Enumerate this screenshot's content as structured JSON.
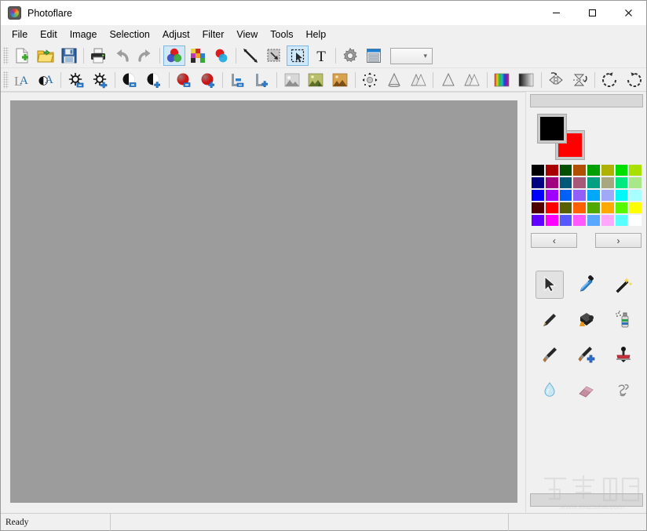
{
  "window": {
    "title": "Photoflare",
    "app_icon": "photoflare-logo-icon",
    "controls": [
      {
        "name": "minimize-button",
        "glyph": "minimize-icon"
      },
      {
        "name": "maximize-button",
        "glyph": "maximize-icon"
      },
      {
        "name": "close-button",
        "glyph": "close-icon"
      }
    ]
  },
  "menubar": {
    "items": [
      {
        "label": "File"
      },
      {
        "label": "Edit"
      },
      {
        "label": "Image"
      },
      {
        "label": "Selection"
      },
      {
        "label": "Adjust"
      },
      {
        "label": "Filter"
      },
      {
        "label": "View"
      },
      {
        "label": "Tools"
      },
      {
        "label": "Help"
      }
    ]
  },
  "toolbar_main": {
    "items": [
      {
        "name": "new-file-button",
        "icon": "new-document-icon",
        "active": false
      },
      {
        "name": "open-file-button",
        "icon": "open-folder-icon",
        "active": false
      },
      {
        "name": "save-file-button",
        "icon": "save-floppy-icon",
        "active": false
      },
      {
        "name": "separator",
        "icon": "separator",
        "active": false
      },
      {
        "name": "print-button",
        "icon": "printer-icon",
        "active": false
      },
      {
        "name": "undo-button",
        "icon": "undo-arrow-icon",
        "active": false
      },
      {
        "name": "redo-button",
        "icon": "redo-arrow-icon",
        "active": false
      },
      {
        "name": "separator",
        "icon": "separator",
        "active": false
      },
      {
        "name": "color-mix-button",
        "icon": "rgb-circles-icon",
        "active": true
      },
      {
        "name": "color-palette-button",
        "icon": "color-grid-icon",
        "active": false
      },
      {
        "name": "color-blend-button",
        "icon": "two-circles-icon",
        "active": false
      },
      {
        "name": "separator",
        "icon": "separator",
        "active": false
      },
      {
        "name": "line-tool-button",
        "icon": "diagonal-line-icon",
        "active": false
      },
      {
        "name": "transform-button",
        "icon": "transform-corner-icon",
        "active": false
      },
      {
        "name": "rectangle-select-button",
        "icon": "marquee-select-icon",
        "active": true
      },
      {
        "name": "text-tool-button",
        "icon": "text-T-icon",
        "active": false
      },
      {
        "name": "separator",
        "icon": "separator",
        "active": false
      },
      {
        "name": "settings-button",
        "icon": "gear-icon",
        "active": false
      },
      {
        "name": "layers-button",
        "icon": "layers-panel-icon",
        "active": false
      }
    ],
    "zoom_combo": {
      "name": "zoom-combo",
      "value": "",
      "chevron": "chevron-down-icon"
    }
  },
  "toolbar_adjust": {
    "items": [
      {
        "name": "auto-levels-button",
        "icon": "LA-levels-icon"
      },
      {
        "name": "auto-contrast-button",
        "icon": "A-contrast-icon"
      },
      {
        "name": "separator",
        "icon": "separator"
      },
      {
        "name": "brightness-decrease-button",
        "icon": "brightness-minus-icon"
      },
      {
        "name": "brightness-increase-button",
        "icon": "brightness-plus-icon"
      },
      {
        "name": "separator",
        "icon": "separator"
      },
      {
        "name": "contrast-decrease-button",
        "icon": "contrast-minus-icon"
      },
      {
        "name": "contrast-increase-button",
        "icon": "contrast-plus-icon"
      },
      {
        "name": "separator",
        "icon": "separator"
      },
      {
        "name": "saturation-decrease-button",
        "icon": "saturation-minus-icon"
      },
      {
        "name": "saturation-increase-button",
        "icon": "saturation-plus-icon"
      },
      {
        "name": "separator",
        "icon": "separator"
      },
      {
        "name": "gamma-decrease-button",
        "icon": "gamma-minus-icon"
      },
      {
        "name": "gamma-increase-button",
        "icon": "gamma-plus-icon"
      },
      {
        "name": "separator",
        "icon": "separator"
      },
      {
        "name": "grayscale-button",
        "icon": "grayscale-photo-icon"
      },
      {
        "name": "colorize-button",
        "icon": "color-photo-icon"
      },
      {
        "name": "sepia-button",
        "icon": "sepia-photo-icon"
      },
      {
        "name": "separator",
        "icon": "separator"
      },
      {
        "name": "despeckle-button",
        "icon": "despeckle-icon"
      },
      {
        "name": "sharpen-button",
        "icon": "sharpen-cone-icon"
      },
      {
        "name": "blur-button",
        "icon": "blur-cones-icon"
      },
      {
        "name": "separator",
        "icon": "separator"
      },
      {
        "name": "emboss-button",
        "icon": "emboss-cone-icon"
      },
      {
        "name": "oilpaint-button",
        "icon": "oilpaint-cones-icon"
      },
      {
        "name": "separator",
        "icon": "separator"
      },
      {
        "name": "rainbow-gradient-button",
        "icon": "rainbow-gradient-icon"
      },
      {
        "name": "gray-gradient-button",
        "icon": "gray-gradient-icon"
      },
      {
        "name": "separator",
        "icon": "separator"
      },
      {
        "name": "flip-horizontal-button",
        "icon": "flip-horizontal-icon"
      },
      {
        "name": "flip-vertical-button",
        "icon": "flip-vertical-icon"
      },
      {
        "name": "separator",
        "icon": "separator"
      },
      {
        "name": "rotate-left-button",
        "icon": "rotate-counterclockwise-icon"
      },
      {
        "name": "rotate-right-button",
        "icon": "rotate-clockwise-icon"
      }
    ]
  },
  "canvas": {
    "name": "image-canvas",
    "background_color": "#9c9c9c"
  },
  "dock": {
    "top_splitter": "dock-top-splitter",
    "bottom_splitter": "dock-bottom-splitter",
    "colors": {
      "foreground": "#000000",
      "background": "#ff0000",
      "palette_rows": [
        [
          "#000000",
          "#a80000",
          "#005000",
          "#b05000",
          "#00a000",
          "#b0b000",
          "#00e000",
          "#a8e000"
        ],
        [
          "#000080",
          "#a00080",
          "#005878",
          "#a85878",
          "#00a080",
          "#a8a880",
          "#00e880",
          "#a8e888"
        ],
        [
          "#0000ff",
          "#a000ff",
          "#0060f8",
          "#9060f8",
          "#00a8f8",
          "#a0a8f8",
          "#00f8f8",
          "#a8ffff"
        ],
        [
          "#500000",
          "#ff0000",
          "#586000",
          "#ff6000",
          "#50a800",
          "#ffa800",
          "#58f800",
          "#ffff00"
        ],
        [
          "#6000ff",
          "#ff00ff",
          "#5858ff",
          "#ff58ff",
          "#58a8ff",
          "#ffa8ff",
          "#58ffff",
          "#ffffff"
        ]
      ],
      "prev_label": "‹",
      "next_label": "›"
    },
    "tools": [
      {
        "name": "tool-pointer",
        "icon": "cursor-arrow-icon",
        "active": true
      },
      {
        "name": "tool-color-picker",
        "icon": "eyedropper-icon",
        "active": false
      },
      {
        "name": "tool-magic-wand",
        "icon": "magic-wand-icon",
        "active": false
      },
      {
        "name": "tool-pencil",
        "icon": "pencil-icon",
        "active": false
      },
      {
        "name": "tool-paint-bucket",
        "icon": "paint-bucket-icon",
        "active": false
      },
      {
        "name": "tool-spray-can",
        "icon": "spray-can-icon",
        "active": false
      },
      {
        "name": "tool-paintbrush",
        "icon": "paintbrush-icon",
        "active": false
      },
      {
        "name": "tool-paintbrush-advanced",
        "icon": "paintbrush-plus-icon",
        "active": false
      },
      {
        "name": "tool-stamp",
        "icon": "clone-stamp-icon",
        "active": false
      },
      {
        "name": "tool-blur",
        "icon": "water-drop-icon",
        "active": false
      },
      {
        "name": "tool-eraser",
        "icon": "eraser-icon",
        "active": false
      },
      {
        "name": "tool-smudge",
        "icon": "smudge-icon",
        "active": false
      }
    ]
  },
  "statusbar": {
    "message": "Ready",
    "cell2": "",
    "cell3": ""
  },
  "watermark": {
    "text": "www.xiazaiba.com",
    "logo": "xiazaiba-logo"
  }
}
